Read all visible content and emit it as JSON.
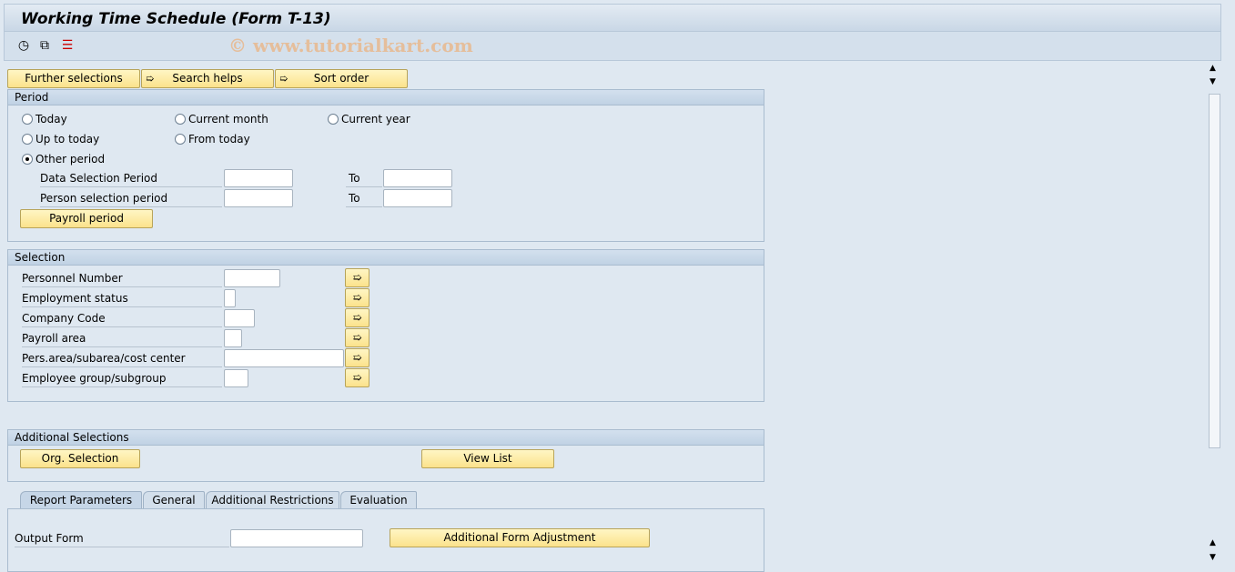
{
  "title": "Working Time Schedule (Form T-13)",
  "toolbar": {
    "icons": [
      "execute-clock-icon",
      "copy-variant-icon",
      "layout-icon"
    ]
  },
  "watermark": "© www.tutorialkart.com",
  "top_buttons": {
    "further": "Further selections",
    "search": "Search helps",
    "sort": "Sort order"
  },
  "period": {
    "header": "Period",
    "today": "Today",
    "current_month": "Current month",
    "current_year": "Current year",
    "up_to_today": "Up to today",
    "from_today": "From today",
    "other_period": "Other period",
    "selected": "Other period",
    "data_sel": "Data Selection Period",
    "person_sel": "Person selection period",
    "to": "To",
    "payroll_btn": "Payroll period"
  },
  "selection": {
    "header": "Selection",
    "rows": [
      "Personnel Number",
      "Employment status",
      "Company Code",
      "Payroll area",
      "Pers.area/subarea/cost center",
      "Employee group/subgroup"
    ]
  },
  "additional": {
    "header": "Additional Selections",
    "org": "Org. Selection",
    "view": "View List"
  },
  "tabs": [
    "Report Parameters",
    "General",
    "Additional Restrictions",
    "Evaluation"
  ],
  "report": {
    "output_form": "Output Form",
    "adj_btn": "Additional Form Adjustment"
  }
}
